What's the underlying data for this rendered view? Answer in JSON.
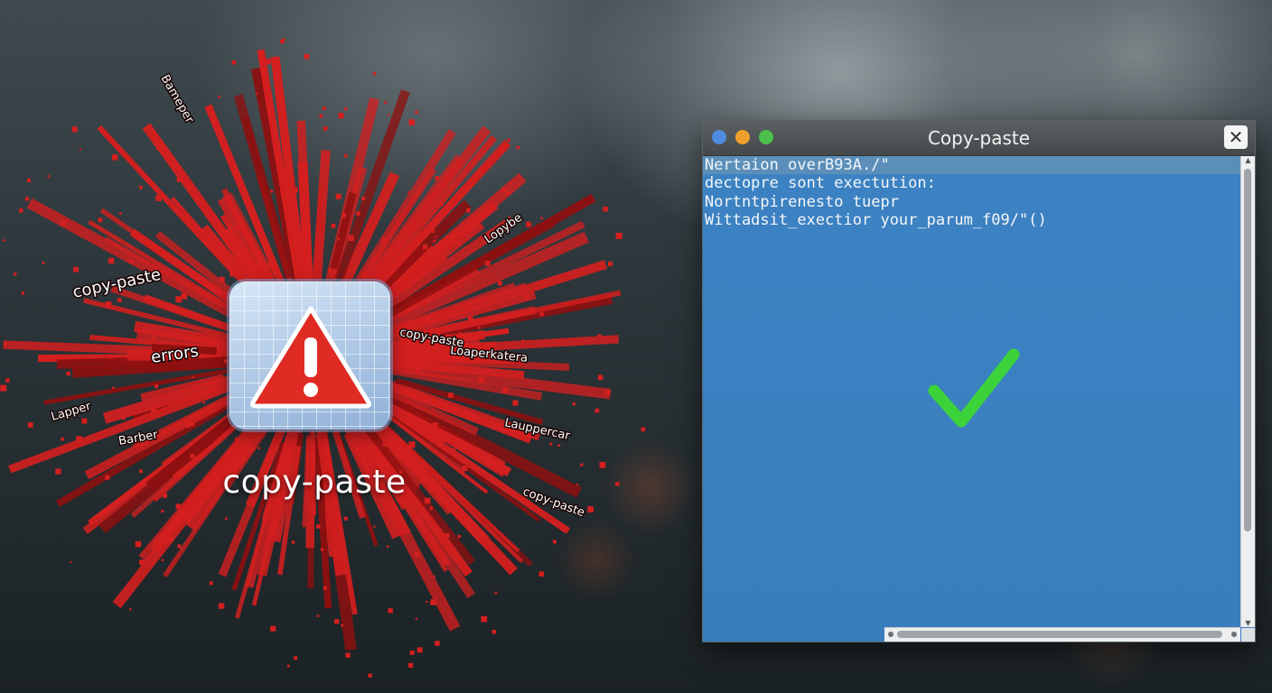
{
  "desktop_icon": {
    "label": "copy-paste",
    "icon_name": "warning-triangle-icon"
  },
  "burst": {
    "labels": [
      "copy-paste",
      "errors",
      "Lauppercar",
      "Loaperkatera",
      "Lapper",
      "Barber",
      "copy-paste",
      "copy-paste",
      "Bameper",
      "Lopybe"
    ]
  },
  "window": {
    "title": "Copy-paste",
    "close_label": "✕",
    "lines": [
      "Nertaion overB93A./\"",
      "dectopre sont exectution:",
      "Nortntpirenesto tuepr",
      "Wittadsit_exectior your_parum_f09/\"()"
    ],
    "status_icon": "checkmark-icon"
  },
  "colors": {
    "burst": "#d41f1f",
    "window_bg": "#3a7dbd",
    "highlight": "#5b8fb9",
    "check": "#3cd33a",
    "warning": "#e02a24"
  }
}
